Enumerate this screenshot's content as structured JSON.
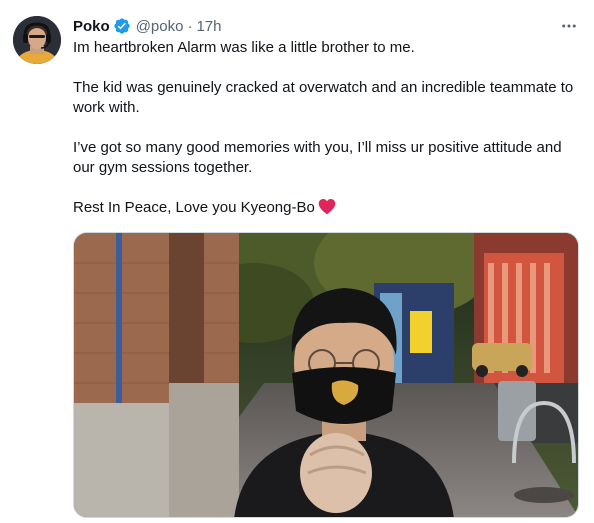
{
  "author": {
    "name": "Poko",
    "handle": "@poko",
    "separator": "·",
    "time": "17h",
    "verified": true
  },
  "tweet": {
    "line1": "Im heartbroken Alarm was like a little brother to me.",
    "line2": "The kid was genuinely cracked at overwatch and an incredible teammate to work with.",
    "line3": "I’ve got so many good memories with you, I’ll miss ur positive attitude and our gym sessions together.",
    "line4": "Rest In Peace, Love you Kyeong-Bo"
  },
  "icons": {
    "more": "more-horizontal-icon",
    "verified": "verified-badge-icon",
    "heart": "red-heart-emoji"
  },
  "colors": {
    "text": "#0f1419",
    "secondary": "#536471",
    "verified": "#1d9bf0",
    "heart": "#e0245e",
    "media_border": "#cfd9de"
  }
}
